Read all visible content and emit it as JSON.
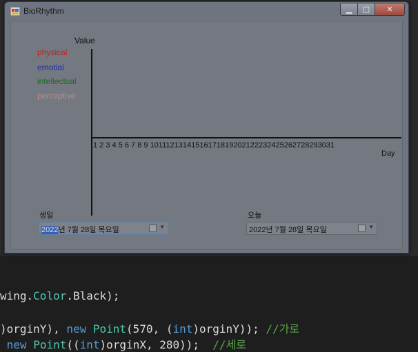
{
  "window": {
    "title": "BioRhythm"
  },
  "legend": {
    "physical": "physical",
    "emotial": "emotial",
    "intellectual": "intellectual",
    "perceptive": "perceptive"
  },
  "chart": {
    "y_label": "Value",
    "x_label": "Day",
    "ticks": "1 2 3 4 5 6 7 8 9 10111213141516171819202122232425262728293031"
  },
  "birth": {
    "label": "생일",
    "year": "2022",
    "rest": "년   7월 28일 목요일"
  },
  "today": {
    "label": "오늘",
    "value": "2022년   7월 28일 목요일"
  },
  "code": {
    "line1_a": "wing.",
    "line1_b": "Color",
    "line1_c": ".Black);",
    "line2_a": ")orginY), ",
    "line2_b": "new",
    "line2_c": " ",
    "line2_d": "Point",
    "line2_e": "(570, (",
    "line2_f": "int",
    "line2_g": ")orginY)); ",
    "line2_h": "//가로",
    "line3_a": " ",
    "line3_b": "new",
    "line3_c": " ",
    "line3_d": "Point",
    "line3_e": "((",
    "line3_f": "int",
    "line3_g": ")orginX, 280));  ",
    "line3_h": "//세로"
  },
  "colors": {
    "physical": "#c82020",
    "emotial": "#1f2fa8",
    "intellectual": "#1d6b24",
    "perceptive": "#b89090"
  }
}
